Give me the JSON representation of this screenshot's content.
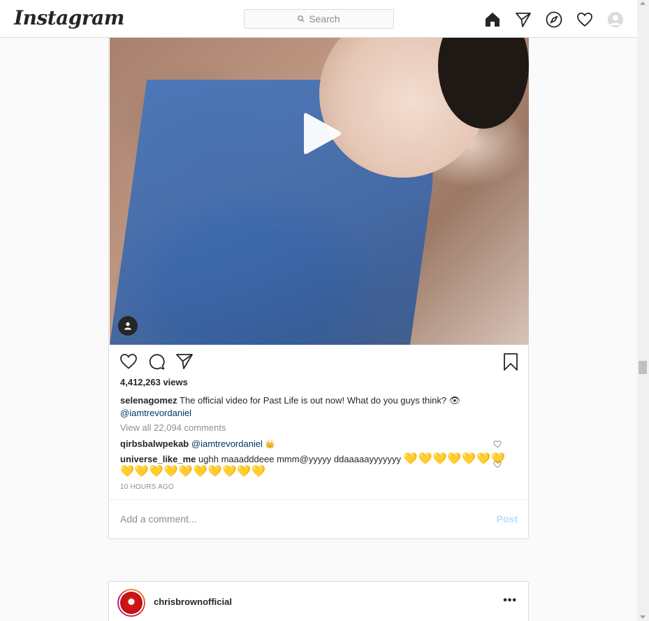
{
  "brand": {
    "logo_text": "Instagram"
  },
  "search": {
    "placeholder": "Search"
  },
  "nav": {
    "icons": [
      "home-icon",
      "direct-icon",
      "explore-icon",
      "activity-heart-icon",
      "profile-avatar-icon"
    ]
  },
  "post": {
    "views": "4,412,263 views",
    "caption": {
      "username": "selenagomez",
      "text": "The official video for Past Life is out now! What do you guys think? 👁",
      "mention": "@iamtrevordaniel"
    },
    "view_all_comments": "View all 22,094 comments",
    "comments": [
      {
        "username": "qirbsbalwpekab",
        "mention": "@iamtrevordaniel",
        "emoji": "👑"
      },
      {
        "username": "universe_like_me",
        "text": "ughh maaadddeee mmm@yyyyy ddaaaaayyyyyyy",
        "hearts_line1": "💛💛💛💛💛💛💛",
        "hearts_line2": "💛💛💛💛💛💛💛💛💛💛"
      }
    ],
    "timestamp": "10 HOURS AGO",
    "add_comment_placeholder": "Add a comment...",
    "post_button": "Post"
  },
  "next_post": {
    "username": "chrisbrownofficial",
    "more_label": "•••"
  },
  "colors": {
    "link": "#003569",
    "muted": "#8e8e8e",
    "border": "#dbdbdb",
    "post_button_disabled": "#b2dffc"
  }
}
